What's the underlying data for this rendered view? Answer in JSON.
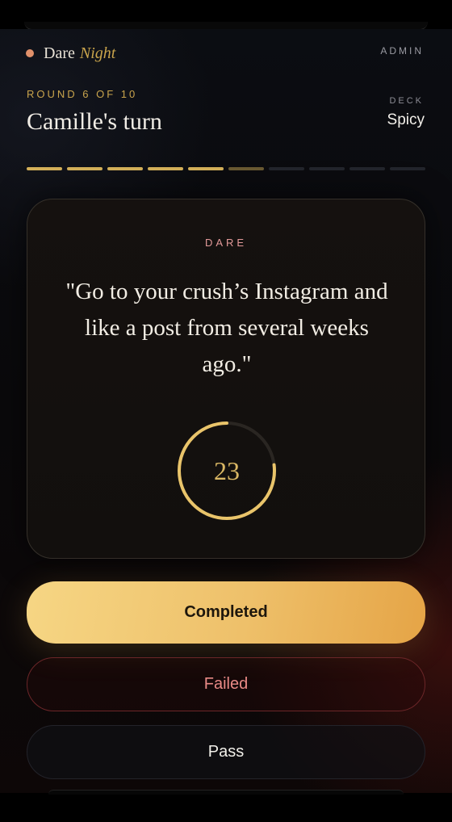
{
  "header": {
    "brand_name": "Dare",
    "brand_accent": "Night",
    "admin_label": "ADMIN"
  },
  "game": {
    "round_label": "ROUND 6 OF 10",
    "turn_label": "Camille's turn",
    "deck_label": "DECK",
    "deck_value": "Spicy",
    "round_current": 6,
    "round_total": 10
  },
  "card": {
    "tag": "DARE",
    "text": "\"Go to your crush’s Instagram and like a post from several weeks ago.\""
  },
  "timer": {
    "seconds_left": "23",
    "fraction_remaining": 0.77
  },
  "actions": {
    "completed_label": "Completed",
    "failed_label": "Failed",
    "pass_label": "Pass"
  },
  "colors": {
    "accent_gold": "#d5b15a",
    "dare_pink": "#e39a9a",
    "failed_red": "#e98a86",
    "brand_dot": "#e0906a"
  }
}
